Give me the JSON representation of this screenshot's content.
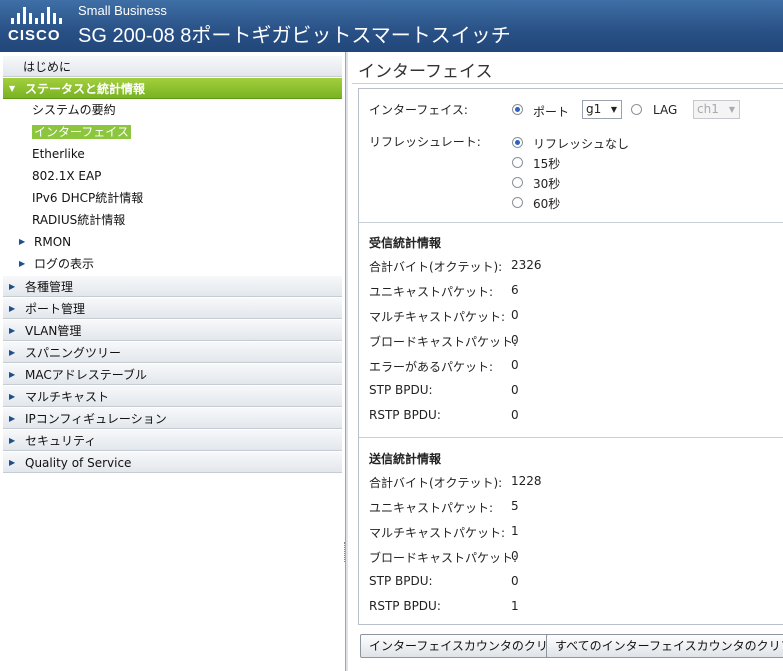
{
  "header": {
    "logo_text": "CISCO",
    "brand": "Small Business",
    "product": "SG 200-08 8ポートギガビットスマートスイッチ"
  },
  "sidebar": {
    "getting_started": "はじめに",
    "status_group": "ステータスと統計情報",
    "status_items": [
      "システムの要約",
      "インターフェイス",
      "Etherlike",
      "802.1X EAP",
      "IPv6 DHCP統計情報",
      "RADIUS統計情報"
    ],
    "status_expandables": [
      "RMON",
      "ログの表示"
    ],
    "groups": [
      "各種管理",
      "ポート管理",
      "VLAN管理",
      "スパニングツリー",
      "MACアドレステーブル",
      "マルチキャスト",
      "IPコンフィギュレーション",
      "セキュリティ",
      "Quality of Service"
    ]
  },
  "main": {
    "title": "インターフェイス",
    "interface_label": "インターフェイス:",
    "port_label": "ポート",
    "port_value": "g1",
    "lag_label": "LAG",
    "lag_value": "ch1",
    "refresh_label": "リフレッシュレート:",
    "refresh_options": [
      "リフレッシュなし",
      "15秒",
      "30秒",
      "60秒"
    ],
    "receive": {
      "heading": "受信統計情報",
      "rows": [
        {
          "label": "合計バイト(オクテット):",
          "value": "2326"
        },
        {
          "label": "ユニキャストパケット:",
          "value": "6"
        },
        {
          "label": "マルチキャストパケット:",
          "value": "0"
        },
        {
          "label": "ブロードキャストパケット:",
          "value": "0"
        },
        {
          "label": "エラーがあるパケット:",
          "value": "0"
        },
        {
          "label": "STP BPDU:",
          "value": "0"
        },
        {
          "label": "RSTP BPDU:",
          "value": "0"
        }
      ]
    },
    "transmit": {
      "heading": "送信統計情報",
      "rows": [
        {
          "label": "合計バイト(オクテット):",
          "value": "1228"
        },
        {
          "label": "ユニキャストパケット:",
          "value": "5"
        },
        {
          "label": "マルチキャストパケット:",
          "value": "1"
        },
        {
          "label": "ブロードキャストパケット:",
          "value": "0"
        },
        {
          "label": "STP BPDU:",
          "value": "0"
        },
        {
          "label": "RSTP BPDU:",
          "value": "1"
        }
      ]
    },
    "buttons": {
      "clear": "インターフェイスカウンタのクリア",
      "clear_all": "すべてのインターフェイスカウンタのクリア"
    }
  }
}
